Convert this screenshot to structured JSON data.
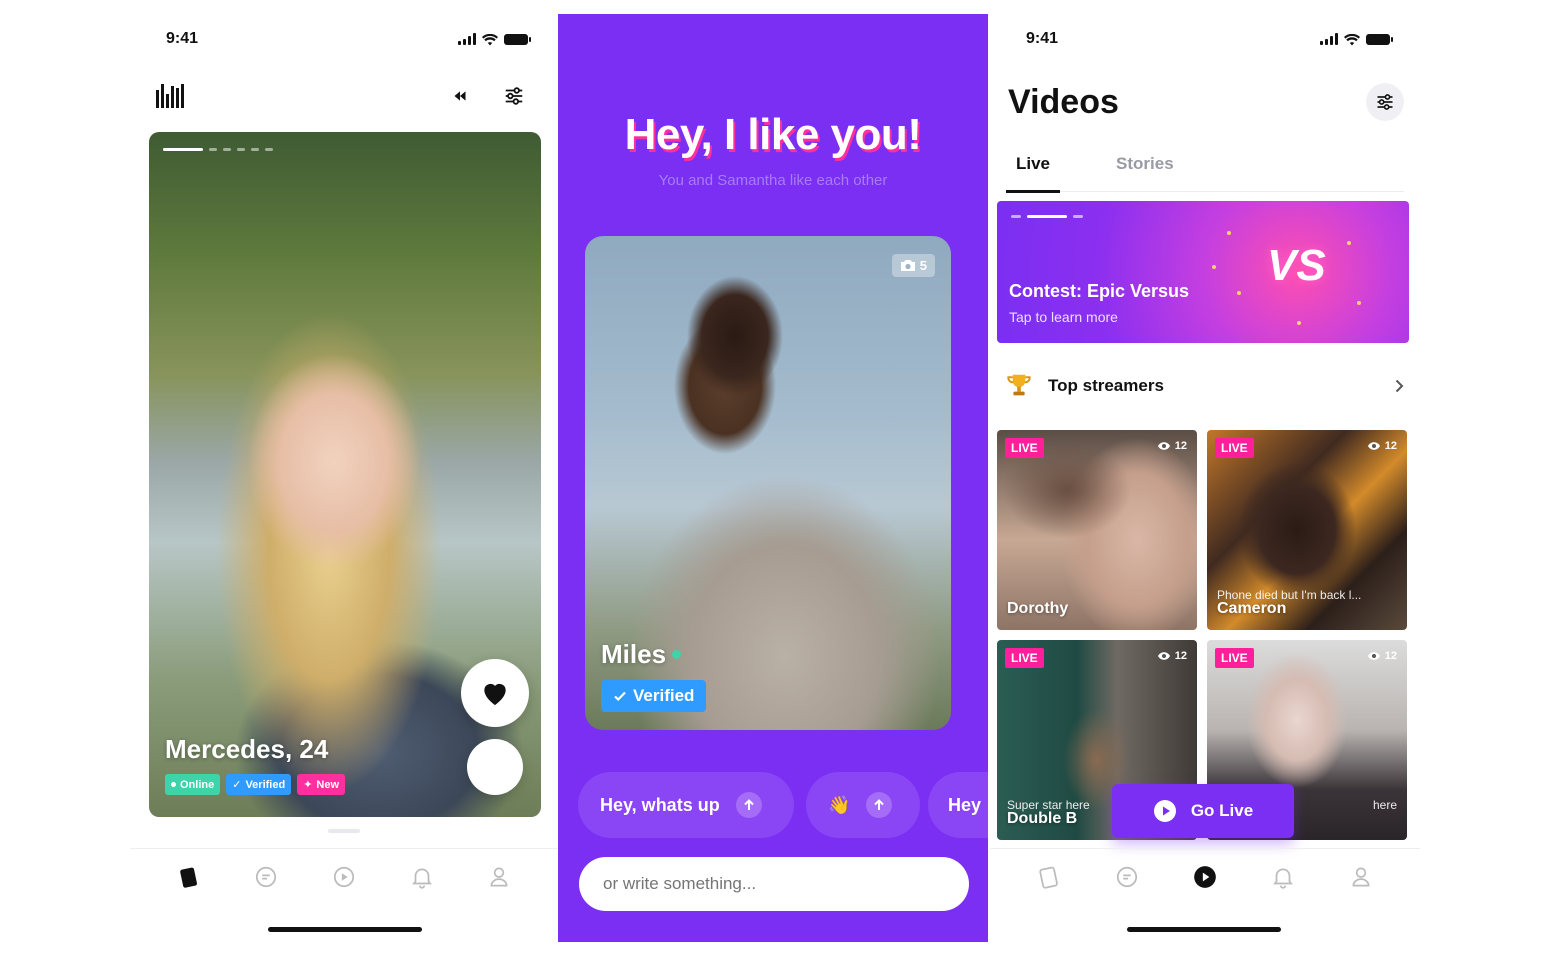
{
  "colors": {
    "purple": "#7b2ff2",
    "pink": "#ff2fa0",
    "green": "#3ed3a8",
    "blue": "#2f9bff"
  },
  "left": {
    "status_time": "9:41",
    "profile": {
      "name": "Mercedes, 24",
      "badges": [
        "Online",
        "Verified",
        "New"
      ]
    },
    "icons": {
      "logo": "logo-mark-icon",
      "boost": "rewind-icon",
      "filter": "sliders-icon",
      "like": "heart-icon"
    },
    "tabs": [
      "cards-icon",
      "chat-icon",
      "play-icon",
      "bell-icon",
      "profile-icon"
    ]
  },
  "middle": {
    "title": "Hey, I like you!",
    "subtitle": "You and Samantha like each other",
    "match": {
      "name": "Miles",
      "photo_count": "5",
      "verified_label": "Verified"
    },
    "quick_replies": [
      "Hey, whats up",
      "👋",
      "Hey"
    ],
    "input_placeholder": "or write something..."
  },
  "right": {
    "status_time": "9:41",
    "title": "Videos",
    "tabs": [
      {
        "label": "Live",
        "active": true
      },
      {
        "label": "Stories",
        "active": false
      }
    ],
    "banner": {
      "title": "Contest: Epic Versus",
      "subtitle": "Tap to learn more",
      "mark": "VS"
    },
    "top_streamers_label": "Top streamers",
    "live_label": "LIVE",
    "streams": [
      {
        "name": "Dorothy",
        "caption": "",
        "viewers": "12"
      },
      {
        "name": "Cameron",
        "caption": "Phone died but I'm back l...",
        "viewers": "12"
      },
      {
        "name": "Double B",
        "caption": "Super star here",
        "viewers": "12"
      },
      {
        "name": "",
        "caption": "here",
        "viewers": "12"
      }
    ],
    "go_live_label": "Go Live"
  }
}
